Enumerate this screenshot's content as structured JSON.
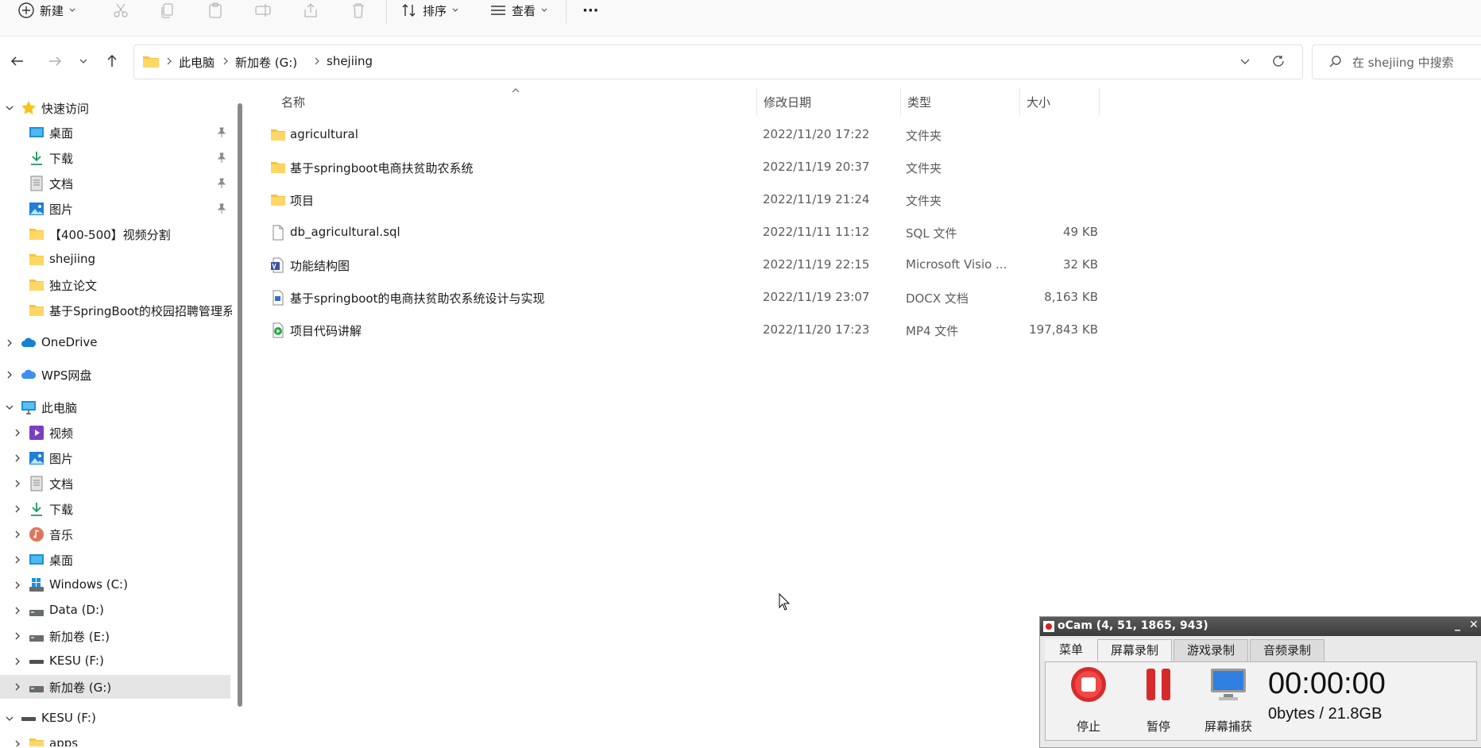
{
  "toolbar": {
    "new_label": "新建",
    "sort_label": "排序",
    "view_label": "查看",
    "more_label": "···"
  },
  "address": {
    "crumbs": [
      "此电脑",
      "新加卷 (G:)",
      "shejiing"
    ]
  },
  "search": {
    "placeholder": "在 shejiing 中搜索"
  },
  "sidebar": {
    "items": [
      {
        "label": "快速访问",
        "icon": "star-icon"
      },
      {
        "label": "桌面",
        "icon": "desktop-icon"
      },
      {
        "label": "下载",
        "icon": "download-icon"
      },
      {
        "label": "文档",
        "icon": "document-icon"
      },
      {
        "label": "图片",
        "icon": "pictures-icon"
      },
      {
        "label": "【400-500】视频分割",
        "icon": "folder-icon"
      },
      {
        "label": "shejiing",
        "icon": "folder-icon"
      },
      {
        "label": "独立论文",
        "icon": "folder-icon"
      },
      {
        "label": "基于SpringBoot的校园招聘管理系",
        "icon": "folder-icon"
      },
      {
        "label": "OneDrive",
        "icon": "cloud-icon"
      },
      {
        "label": "WPS网盘",
        "icon": "cloud-icon"
      },
      {
        "label": "此电脑",
        "icon": "computer-icon"
      },
      {
        "label": "视频",
        "icon": "video-icon"
      },
      {
        "label": "图片",
        "icon": "pictures-icon"
      },
      {
        "label": "文档",
        "icon": "document-icon"
      },
      {
        "label": "下载",
        "icon": "download-icon"
      },
      {
        "label": "音乐",
        "icon": "music-icon"
      },
      {
        "label": "桌面",
        "icon": "desktop-icon"
      },
      {
        "label": "Windows (C:)",
        "icon": "drive-icon"
      },
      {
        "label": "Data (D:)",
        "icon": "drive-icon"
      },
      {
        "label": "新加卷 (E:)",
        "icon": "drive-icon"
      },
      {
        "label": "KESU  (F:)",
        "icon": "usb-drive-icon"
      },
      {
        "label": "新加卷 (G:)",
        "icon": "drive-icon"
      },
      {
        "label": "KESU  (F:)",
        "icon": "usb-drive-icon"
      },
      {
        "label": "apps",
        "icon": "folder-icon"
      }
    ]
  },
  "columns": {
    "name": "名称",
    "date": "修改日期",
    "type": "类型",
    "size": "大小"
  },
  "files": [
    {
      "name": "agricultural",
      "date": "2022/11/20 17:22",
      "type": "文件夹",
      "size": "",
      "icon": "folder-icon"
    },
    {
      "name": "基于springboot电商扶贫助农系统",
      "date": "2022/11/19 20:37",
      "type": "文件夹",
      "size": "",
      "icon": "folder-icon"
    },
    {
      "name": "项目",
      "date": "2022/11/19 21:24",
      "type": "文件夹",
      "size": "",
      "icon": "folder-icon"
    },
    {
      "name": "db_agricultural.sql",
      "date": "2022/11/11 11:12",
      "type": "SQL 文件",
      "size": "49 KB",
      "icon": "file-icon"
    },
    {
      "name": "功能结构图",
      "date": "2022/11/19 22:15",
      "type": "Microsoft Visio ...",
      "size": "32 KB",
      "icon": "visio-icon"
    },
    {
      "name": "基于springboot的电商扶贫助农系统设计与实现",
      "date": "2022/11/19 23:07",
      "type": "DOCX 文档",
      "size": "8,163 KB",
      "icon": "docx-icon"
    },
    {
      "name": "项目代码讲解",
      "date": "2022/11/20 17:23",
      "type": "MP4 文件",
      "size": "197,843 KB",
      "icon": "video-file-icon"
    }
  ],
  "ocam": {
    "title": "oCam (4, 51, 1865, 943)",
    "minimize": "_",
    "close": "✕",
    "tabs": [
      "菜单",
      "屏幕录制",
      "游戏录制",
      "音频录制"
    ],
    "stop_label": "停止",
    "pause_label": "暂停",
    "capture_label": "屏幕捕获",
    "time": "00:00:00",
    "bytes": "0bytes / 21.8GB"
  }
}
